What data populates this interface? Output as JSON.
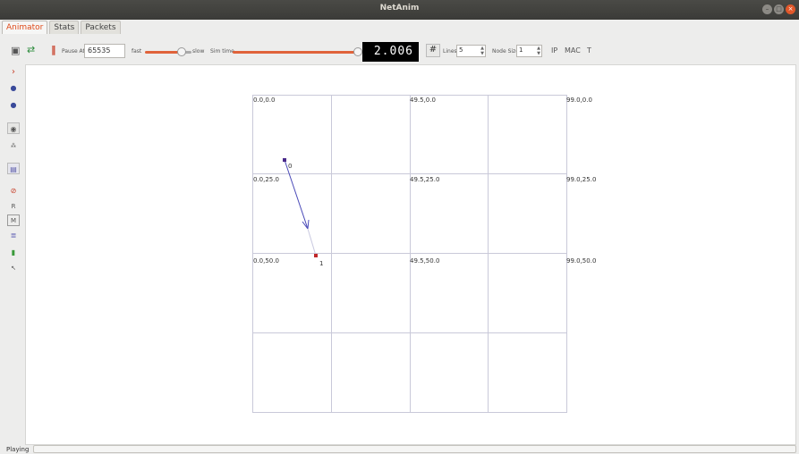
{
  "window": {
    "title": "NetAnim"
  },
  "tabs": [
    {
      "label": "Animator",
      "active": true
    },
    {
      "label": "Stats",
      "active": false
    },
    {
      "label": "Packets",
      "active": false
    }
  ],
  "toolbar": {
    "pause_at_label": "Pause At",
    "pause_at_value": "65535",
    "fast_label": "fast",
    "slow_label": "slow",
    "sim_time_label": "Sim time",
    "sim_time_display": "2.006",
    "lines_label": "Lines",
    "lines_value": "5",
    "node_size_label": "Node Size",
    "node_size_value": "1",
    "ip_label": "IP",
    "mac_label": "MAC",
    "t_label": "T"
  },
  "sidebar": {
    "icons": [
      "chevron-right-icon",
      "pin-icon",
      "pin-icon",
      "zoom-icon",
      "node-size-icon",
      "settings-icon",
      "forbid-icon"
    ],
    "r_label": "R",
    "m_label": "M"
  },
  "grid": {
    "labels": {
      "r0c0": "0.0,0.0",
      "r0c2": "49.5,0.0",
      "r0c4": "99.0,0.0",
      "r1c0": "0.0,25.0",
      "r1c2": "49.5,25.0",
      "r1c4": "99.0,25.0",
      "r2c0": "0.0,50.0",
      "r2c2": "49.5,50.0",
      "r2c4": "99.0,50.0"
    }
  },
  "nodes": [
    {
      "id": "0",
      "color": "#4a2a8a"
    },
    {
      "id": "1",
      "color": "#c0282a"
    }
  ],
  "status": {
    "text": "Playing"
  },
  "colors": {
    "accent": "#df4a1a",
    "packet_line": "#4a4ab8"
  }
}
